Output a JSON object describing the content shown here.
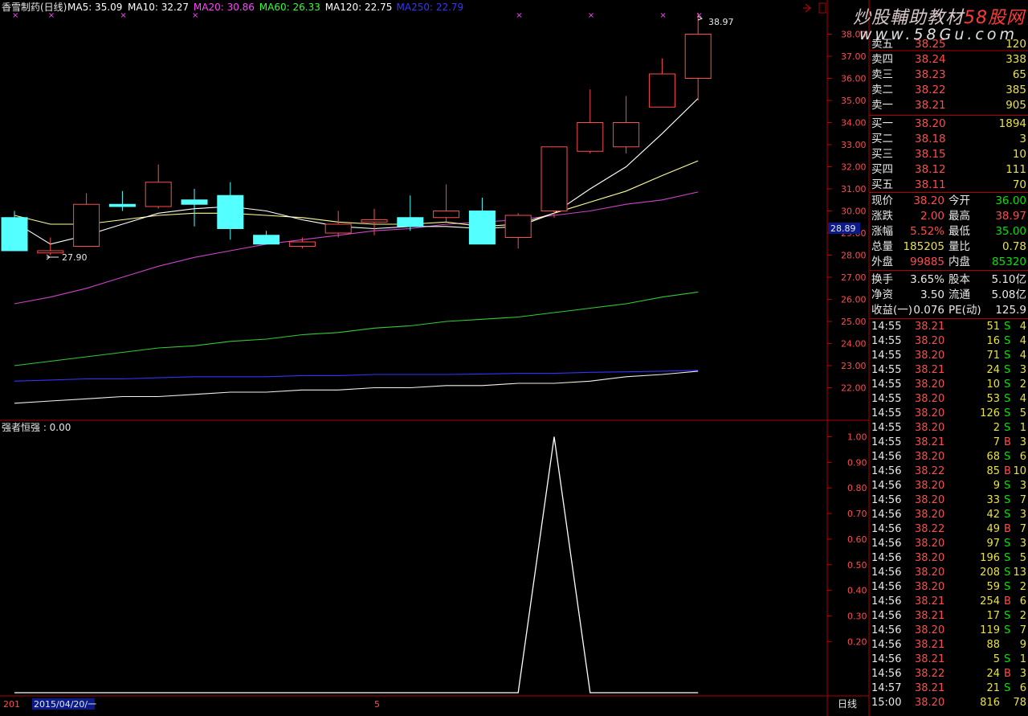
{
  "header": {
    "stock_name": "香雪制药(日线)",
    "ma_legend": [
      {
        "label": "MA5: 35.09",
        "color": "#ffffff"
      },
      {
        "label": "MA10: 32.27",
        "color": "#ffffff"
      },
      {
        "label": "MA20: 30.86",
        "color": "#ff44ff"
      },
      {
        "label": "MA60: 26.33",
        "color": "#33ff33"
      },
      {
        "label": "MA120: 22.75",
        "color": "#ffffff"
      },
      {
        "label": "MA250: 22.79",
        "color": "#3333ff"
      }
    ],
    "icons": [
      "arrow-icon",
      "box-icon"
    ]
  },
  "watermark": {
    "title_a": "炒股輔助教材",
    "title_b": "58股网",
    "url": "www.58Gu.com"
  },
  "price_chart": {
    "y_ticks": [
      "38.00",
      "37.00",
      "36.00",
      "35.00",
      "34.00",
      "33.00",
      "32.00",
      "31.00",
      "30.00",
      "29.00",
      "28.00",
      "27.00",
      "26.00",
      "25.00",
      "24.00",
      "23.00",
      "22.00"
    ],
    "current_price_tag": "28.89",
    "high_label": "38.97",
    "low_label": "27.90",
    "candles": [
      {
        "o": 28.2,
        "c": 29.7,
        "h": 30.0,
        "l": 28.2,
        "up": false
      },
      {
        "o": 28.1,
        "c": 28.2,
        "h": 28.8,
        "l": 28.0,
        "up": true
      },
      {
        "o": 28.4,
        "c": 30.3,
        "h": 30.8,
        "l": 28.4,
        "up": true
      },
      {
        "o": 30.2,
        "c": 30.3,
        "h": 30.9,
        "l": 30.0,
        "up": false
      },
      {
        "o": 30.2,
        "c": 31.3,
        "h": 32.1,
        "l": 30.1,
        "up": true
      },
      {
        "o": 30.5,
        "c": 30.3,
        "h": 31.0,
        "l": 29.3,
        "up": false
      },
      {
        "o": 30.7,
        "c": 29.2,
        "h": 31.3,
        "l": 28.7,
        "up": false
      },
      {
        "o": 28.9,
        "c": 28.5,
        "h": 29.1,
        "l": 28.5,
        "up": false
      },
      {
        "o": 28.4,
        "c": 28.6,
        "h": 28.8,
        "l": 28.3,
        "up": true
      },
      {
        "o": 29.0,
        "c": 29.4,
        "h": 30.0,
        "l": 28.8,
        "up": true
      },
      {
        "o": 29.5,
        "c": 29.6,
        "h": 30.1,
        "l": 28.9,
        "up": true
      },
      {
        "o": 29.7,
        "c": 29.3,
        "h": 30.7,
        "l": 29.1,
        "up": false
      },
      {
        "o": 29.7,
        "c": 30.0,
        "h": 31.2,
        "l": 29.5,
        "up": true
      },
      {
        "o": 30.0,
        "c": 28.5,
        "h": 30.6,
        "l": 28.5,
        "up": false
      },
      {
        "o": 28.8,
        "c": 29.8,
        "h": 29.9,
        "l": 28.3,
        "up": true
      },
      {
        "o": 30.0,
        "c": 32.9,
        "h": 32.9,
        "l": 29.7,
        "up": true
      },
      {
        "o": 32.7,
        "c": 34.0,
        "h": 35.5,
        "l": 32.6,
        "up": true
      },
      {
        "o": 32.9,
        "c": 34.0,
        "h": 35.2,
        "l": 32.6,
        "up": true
      },
      {
        "o": 34.7,
        "c": 36.2,
        "h": 36.9,
        "l": 34.7,
        "up": true
      },
      {
        "o": 36.0,
        "c": 38.0,
        "h": 38.97,
        "l": 35.0,
        "up": true
      }
    ],
    "ma5": [
      29.5,
      28.5,
      28.9,
      29.4,
      29.9,
      30.1,
      30.2,
      30.0,
      29.6,
      29.3,
      29.2,
      29.3,
      29.3,
      29.2,
      29.3,
      29.9,
      31.0,
      32.0,
      33.5,
      35.09
    ],
    "ma10": [
      29.8,
      29.4,
      29.4,
      29.6,
      29.8,
      29.9,
      29.9,
      29.8,
      29.7,
      29.5,
      29.4,
      29.4,
      29.5,
      29.3,
      29.4,
      29.9,
      30.4,
      30.9,
      31.6,
      32.27
    ],
    "ma20": [
      25.8,
      26.1,
      26.5,
      27.0,
      27.5,
      27.9,
      28.2,
      28.5,
      28.7,
      28.9,
      29.1,
      29.2,
      29.4,
      29.5,
      29.6,
      29.8,
      30.0,
      30.3,
      30.5,
      30.86
    ],
    "ma60": [
      23.0,
      23.2,
      23.4,
      23.6,
      23.8,
      23.9,
      24.1,
      24.2,
      24.4,
      24.5,
      24.7,
      24.8,
      25.0,
      25.1,
      25.2,
      25.4,
      25.6,
      25.8,
      26.1,
      26.33
    ],
    "ma120": [
      21.3,
      21.4,
      21.5,
      21.6,
      21.6,
      21.7,
      21.8,
      21.8,
      21.9,
      21.9,
      22.0,
      22.0,
      22.1,
      22.1,
      22.2,
      22.2,
      22.3,
      22.5,
      22.6,
      22.75
    ],
    "ma250": [
      22.3,
      22.35,
      22.4,
      22.4,
      22.45,
      22.5,
      22.5,
      22.5,
      22.55,
      22.55,
      22.6,
      22.6,
      22.6,
      22.62,
      22.65,
      22.65,
      22.7,
      22.72,
      22.75,
      22.79
    ]
  },
  "indicator": {
    "title": "强者恒强 : 0.00",
    "y_ticks": [
      "1.00",
      "0.90",
      "0.80",
      "0.70",
      "0.60",
      "0.50",
      "0.40",
      "0.30",
      "0.20"
    ],
    "values": [
      0,
      0,
      0,
      0,
      0,
      0,
      0,
      0,
      0,
      0,
      0,
      0,
      0,
      0,
      0,
      1,
      0,
      0,
      0,
      0
    ]
  },
  "bottom_bar": {
    "year": "201",
    "date": "2015/04/20/一",
    "mark": "5",
    "period": "日线"
  },
  "order_book": {
    "asks": [
      {
        "label": "卖五",
        "price": "38.25",
        "vol": "120"
      },
      {
        "label": "卖四",
        "price": "38.24",
        "vol": "338"
      },
      {
        "label": "卖三",
        "price": "38.23",
        "vol": "65"
      },
      {
        "label": "卖二",
        "price": "38.22",
        "vol": "385"
      },
      {
        "label": "卖一",
        "price": "38.21",
        "vol": "905"
      }
    ],
    "bids": [
      {
        "label": "买一",
        "price": "38.20",
        "vol": "1894"
      },
      {
        "label": "买二",
        "price": "38.18",
        "vol": "3"
      },
      {
        "label": "买三",
        "price": "38.15",
        "vol": "10"
      },
      {
        "label": "买四",
        "price": "38.12",
        "vol": "111"
      },
      {
        "label": "买五",
        "price": "38.11",
        "vol": "70"
      }
    ]
  },
  "stats": [
    {
      "l1": "现价",
      "v1": "38.20",
      "c1": "red",
      "l2": "今开",
      "v2": "36.00",
      "c2": "green"
    },
    {
      "l1": "涨跌",
      "v1": "2.00",
      "c1": "red",
      "l2": "最高",
      "v2": "38.97",
      "c2": "red"
    },
    {
      "l1": "涨幅",
      "v1": "5.52%",
      "c1": "red",
      "l2": "最低",
      "v2": "35.00",
      "c2": "green"
    },
    {
      "l1": "总量",
      "v1": "185205",
      "c1": "yellow",
      "l2": "量比",
      "v2": "0.78",
      "c2": "yellow"
    },
    {
      "l1": "外盘",
      "v1": "99885",
      "c1": "red",
      "l2": "内盘",
      "v2": "85320",
      "c2": "green"
    }
  ],
  "fundamentals": [
    {
      "l1": "换手",
      "v1": "3.65%",
      "l2": "股本",
      "v2": "5.10亿"
    },
    {
      "l1": "净资",
      "v1": "3.50",
      "l2": "流通",
      "v2": "5.08亿"
    },
    {
      "l1": "收益(一)",
      "v1": "0.076",
      "l2": "PE(动)",
      "v2": "125.9"
    }
  ],
  "ticks": [
    {
      "t": "14:55",
      "p": "38.21",
      "v": "51",
      "s": "S",
      "n": "4"
    },
    {
      "t": "14:55",
      "p": "38.20",
      "v": "16",
      "s": "S",
      "n": "4"
    },
    {
      "t": "14:55",
      "p": "38.20",
      "v": "71",
      "s": "S",
      "n": "4"
    },
    {
      "t": "14:55",
      "p": "38.21",
      "v": "24",
      "s": "S",
      "n": "3"
    },
    {
      "t": "14:55",
      "p": "38.20",
      "v": "10",
      "s": "S",
      "n": "2"
    },
    {
      "t": "14:55",
      "p": "38.20",
      "v": "53",
      "s": "S",
      "n": "4"
    },
    {
      "t": "14:55",
      "p": "38.20",
      "v": "126",
      "s": "S",
      "n": "5"
    },
    {
      "t": "14:55",
      "p": "38.20",
      "v": "2",
      "s": "S",
      "n": "1"
    },
    {
      "t": "14:55",
      "p": "38.21",
      "v": "7",
      "s": "B",
      "n": "3"
    },
    {
      "t": "14:56",
      "p": "38.20",
      "v": "68",
      "s": "S",
      "n": "6"
    },
    {
      "t": "14:56",
      "p": "38.22",
      "v": "85",
      "s": "B",
      "n": "10"
    },
    {
      "t": "14:56",
      "p": "38.20",
      "v": "9",
      "s": "S",
      "n": "3"
    },
    {
      "t": "14:56",
      "p": "38.20",
      "v": "33",
      "s": "S",
      "n": "7"
    },
    {
      "t": "14:56",
      "p": "38.20",
      "v": "42",
      "s": "S",
      "n": "3"
    },
    {
      "t": "14:56",
      "p": "38.22",
      "v": "49",
      "s": "B",
      "n": "7"
    },
    {
      "t": "14:56",
      "p": "38.20",
      "v": "97",
      "s": "S",
      "n": "3"
    },
    {
      "t": "14:56",
      "p": "38.20",
      "v": "196",
      "s": "S",
      "n": "5"
    },
    {
      "t": "14:56",
      "p": "38.20",
      "v": "208",
      "s": "S",
      "n": "13"
    },
    {
      "t": "14:56",
      "p": "38.20",
      "v": "59",
      "s": "S",
      "n": "2"
    },
    {
      "t": "14:56",
      "p": "38.21",
      "v": "254",
      "s": "B",
      "n": "6"
    },
    {
      "t": "14:56",
      "p": "38.21",
      "v": "17",
      "s": "S",
      "n": "2"
    },
    {
      "t": "14:56",
      "p": "38.20",
      "v": "119",
      "s": "S",
      "n": "7"
    },
    {
      "t": "14:56",
      "p": "38.21",
      "v": "88",
      "s": "",
      "n": "9"
    },
    {
      "t": "14:56",
      "p": "38.21",
      "v": "5",
      "s": "S",
      "n": "1"
    },
    {
      "t": "14:56",
      "p": "38.22",
      "v": "24",
      "s": "B",
      "n": "3"
    },
    {
      "t": "14:57",
      "p": "38.21",
      "v": "21",
      "s": "S",
      "n": "6"
    },
    {
      "t": "15:00",
      "p": "38.20",
      "v": "816",
      "s": "",
      "n": "78"
    }
  ],
  "colors": {
    "up": "#ff4c4c",
    "down": "#54ffff",
    "grid": "#aa0000",
    "axis": "#cc0000"
  }
}
